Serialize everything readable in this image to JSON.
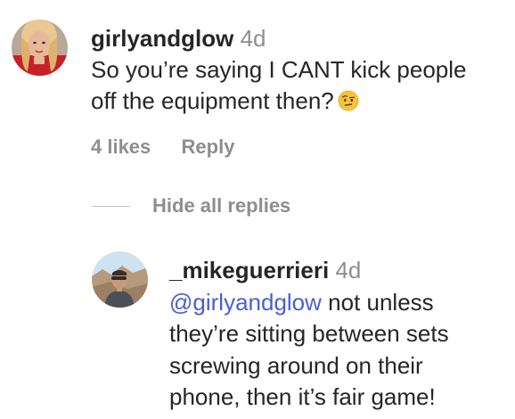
{
  "comment": {
    "username": "girlyandglow",
    "time": "4d",
    "text_line1": "So you’re saying I CANT kick people",
    "text_line2": "off the equipment then?",
    "emoji_icon": "face-with-raised-eyebrow-emoji",
    "likes": "4 likes",
    "reply_label": "Reply"
  },
  "replies_toggle": {
    "label": "Hide all replies"
  },
  "reply": {
    "username": "_mikeguerrieri",
    "time": "4d",
    "mention": "@girlyandglow",
    "text_line1_rest": " not unless",
    "text_line2": "they’re sitting between sets",
    "text_line3": "screwing around on their",
    "text_line4": "phone, then it’s fair game!"
  },
  "colors": {
    "text": "#262626",
    "muted": "#8e8e8e",
    "mention": "#4a5fd0",
    "divider": "#c7c7c7"
  }
}
